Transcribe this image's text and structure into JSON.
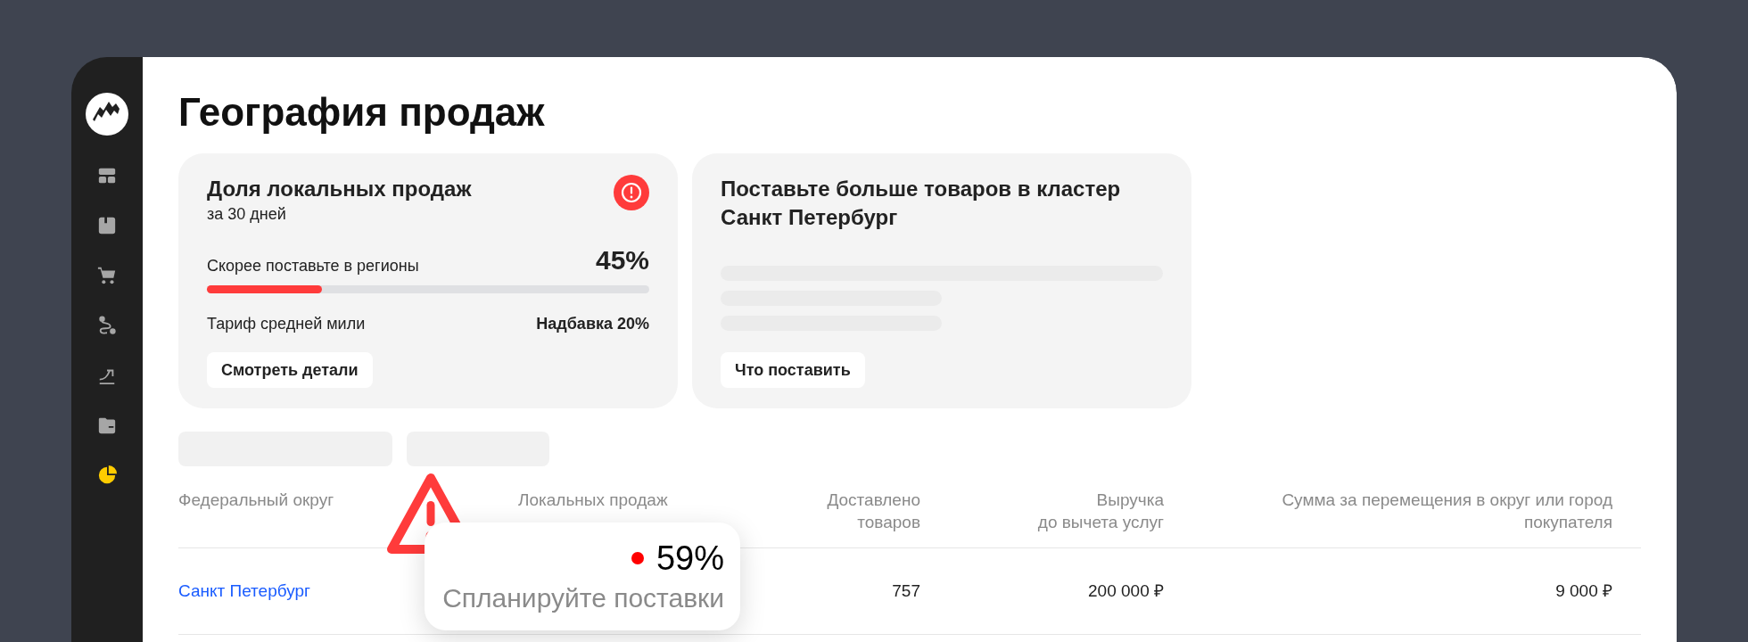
{
  "sidebar": {
    "items": [
      {
        "kind": "dashboard",
        "selected": false
      },
      {
        "kind": "box",
        "selected": false
      },
      {
        "kind": "cart",
        "selected": false
      },
      {
        "kind": "route",
        "selected": false
      },
      {
        "kind": "growth",
        "selected": false
      },
      {
        "kind": "wallet",
        "selected": false
      },
      {
        "kind": "pie",
        "selected": true
      }
    ]
  },
  "page": {
    "title": "География продаж"
  },
  "cards": [
    {
      "kind": "share",
      "title": "Доля локальных продаж",
      "subtitle": "за 30 дней",
      "progress_label": "Скорее поставьте в регионы",
      "value": "45%",
      "level": 0.26,
      "tariff_label": "Тариф средней мили",
      "tariff_value": "Надбавка 20%",
      "button": "Смотреть детали"
    },
    {
      "kind": "advice",
      "title": "Поставьте больше товаров в кластер Санкт Петербург",
      "button": "Что поставить"
    }
  ],
  "table": {
    "columns": [
      "Федеральный округ",
      "Локальных продаж",
      "Доставлено\nтоваров",
      "Выручка\nдо вычета услуг",
      "Сумма за перемещения в округ или город\nпокупателя"
    ],
    "rows": [
      {
        "district": "Санкт Петербург",
        "delivered": "757",
        "revenue": "200 000 ₽",
        "moving_sum": "9 000 ₽"
      }
    ]
  },
  "tooltip": {
    "value": "59%",
    "hint": "Спланируйте поставки"
  }
}
